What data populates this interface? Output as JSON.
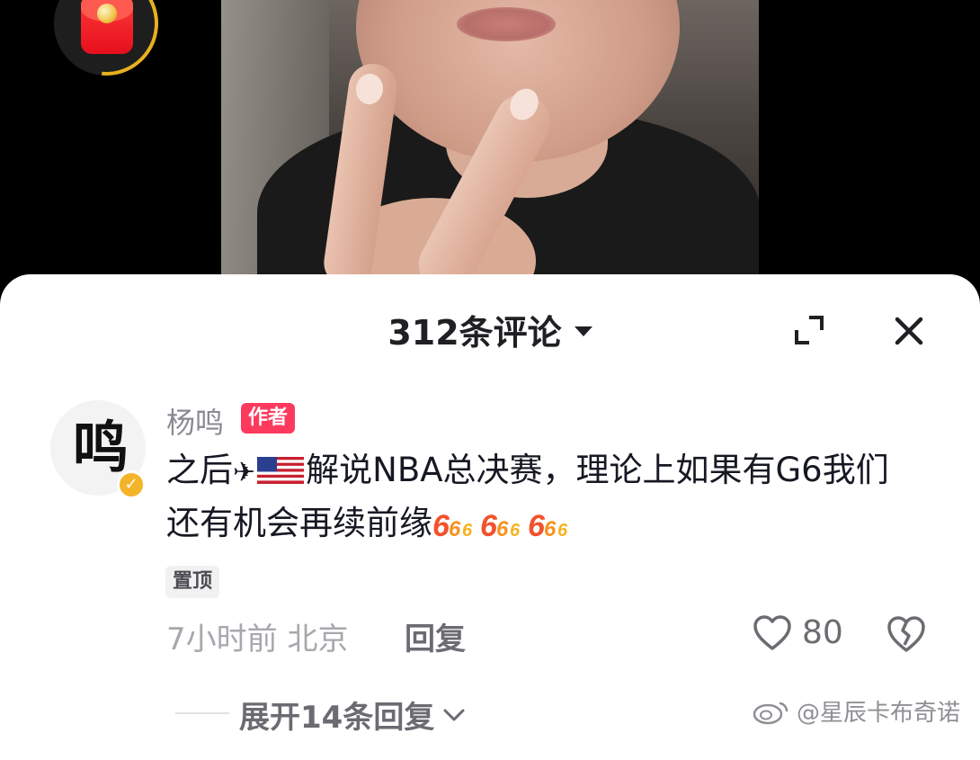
{
  "header": {
    "comment_count_title": "312条评论"
  },
  "comment": {
    "username": "杨鸣",
    "author_badge": "作者",
    "text_part1": "之后",
    "plane": "✈",
    "text_part2": "解说NBA总决赛，理论上如果有G6我们还有机会再续前缘",
    "pin_label": "置顶",
    "time_location": "7小时前 北京",
    "reply_label": "回复",
    "like_count": "80",
    "expand_replies_label": "展开14条回复",
    "avatar_text": "鸣"
  },
  "watermark": {
    "text": "@星辰卡布奇诺"
  },
  "colors": {
    "badge": "#fd3a5e",
    "verified": "#f4b42a",
    "redpacket": "#e50f1c"
  }
}
